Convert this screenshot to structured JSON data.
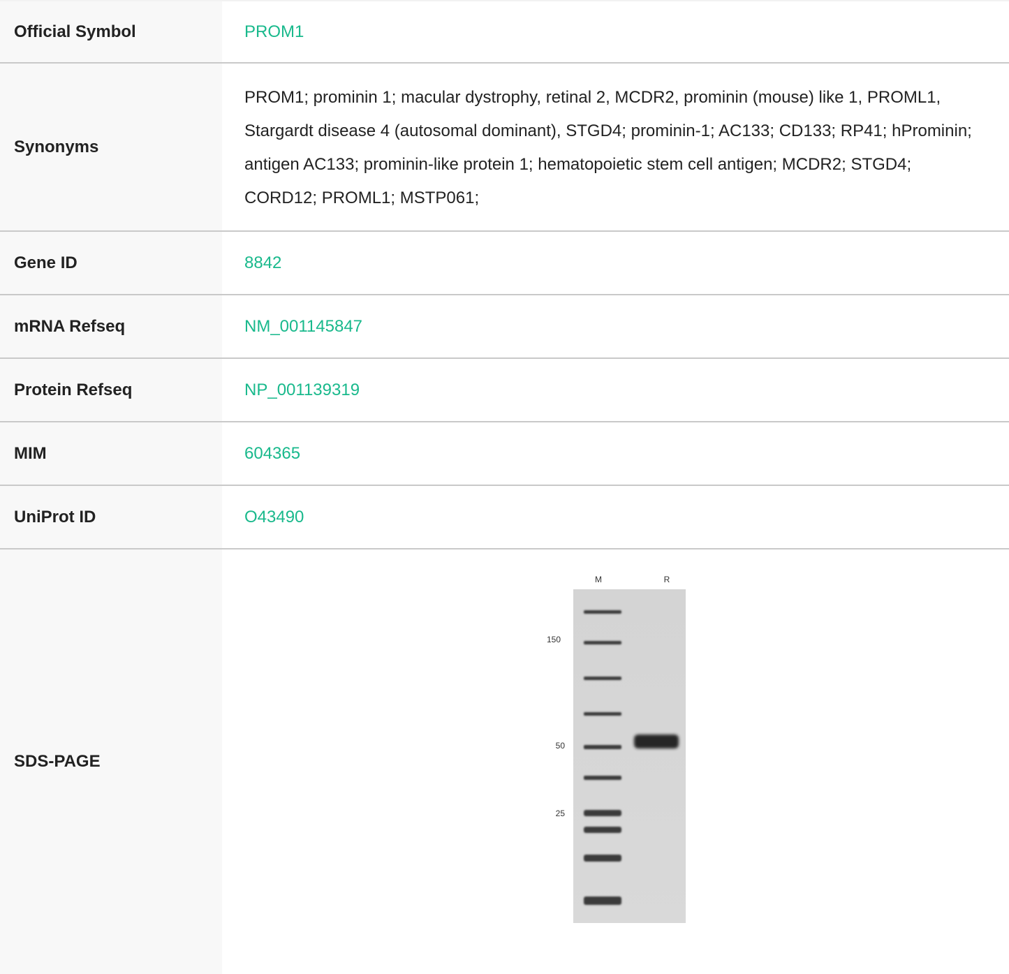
{
  "rows": [
    {
      "label": "Official Symbol",
      "value": "PROM1"
    },
    {
      "label": "Synonyms",
      "value": "PROM1; prominin 1; macular dystrophy, retinal 2, MCDR2, prominin (mouse) like 1, PROML1, Stargardt disease 4 (autosomal dominant), STGD4; prominin-1; AC133; CD133; RP41; hProminin; antigen AC133; prominin-like protein 1; hematopoietic stem cell antigen; MCDR2; STGD4; CORD12; PROML1; MSTP061;"
    },
    {
      "label": "Gene ID",
      "value": "8842"
    },
    {
      "label": "mRNA Refseq",
      "value": "NM_001145847"
    },
    {
      "label": "Protein Refseq",
      "value": "NP_001139319"
    },
    {
      "label": "MIM",
      "value": "604365"
    },
    {
      "label": "UniProt ID",
      "value": "O43490"
    },
    {
      "label": "SDS-PAGE",
      "value": ""
    }
  ],
  "gel": {
    "lanes": [
      "M",
      "R"
    ],
    "markers": [
      "150",
      "50",
      "25"
    ]
  },
  "colors": {
    "link": "#19b98c",
    "label_bg": "#f8f8f8",
    "divider": "#c9c9c9"
  }
}
